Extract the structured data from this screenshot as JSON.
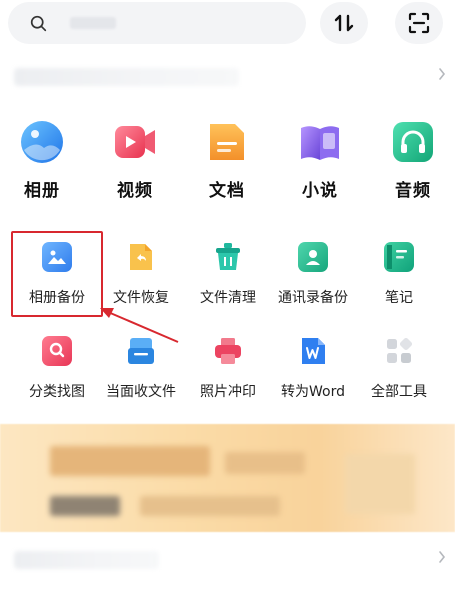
{
  "topbar": {
    "search_icon": "search-icon",
    "sort_icon": "sort-arrows-icon",
    "scan_icon": "scan-icon"
  },
  "categories": [
    {
      "label": "相册",
      "icon": "album-icon",
      "color": "#2a8df0"
    },
    {
      "label": "视频",
      "icon": "video-icon",
      "color": "#ef4d63"
    },
    {
      "label": "文档",
      "icon": "document-icon",
      "color": "#f6a43b"
    },
    {
      "label": "小说",
      "icon": "book-icon",
      "color": "#8a63e6"
    },
    {
      "label": "音频",
      "icon": "headphone-icon",
      "color": "#22c08b"
    }
  ],
  "tools": [
    {
      "label": "相册备份",
      "icon": "photo-backup-icon",
      "color": "#3f8df3"
    },
    {
      "label": "文件恢复",
      "icon": "file-restore-icon",
      "color": "#f7b23b"
    },
    {
      "label": "文件清理",
      "icon": "file-clean-icon",
      "color": "#21b7a0"
    },
    {
      "label": "通讯录备份",
      "icon": "contacts-backup-icon",
      "color": "#20b98f"
    },
    {
      "label": "笔记",
      "icon": "note-icon",
      "color": "#19b38a"
    },
    {
      "label": "分类找图",
      "icon": "image-search-icon",
      "color": "#f0506a"
    },
    {
      "label": "当面收文件",
      "icon": "receive-file-icon",
      "color": "#2b8fe6"
    },
    {
      "label": "照片冲印",
      "icon": "photo-print-icon",
      "color": "#ef4a62"
    },
    {
      "label": "转为Word",
      "icon": "word-convert-icon",
      "color": "#2f7ff0"
    },
    {
      "label": "全部工具",
      "icon": "all-tools-icon",
      "color": "#cfd3d8"
    }
  ],
  "colors": {
    "highlight": "#d8282f",
    "banner": "#fbdca8"
  }
}
